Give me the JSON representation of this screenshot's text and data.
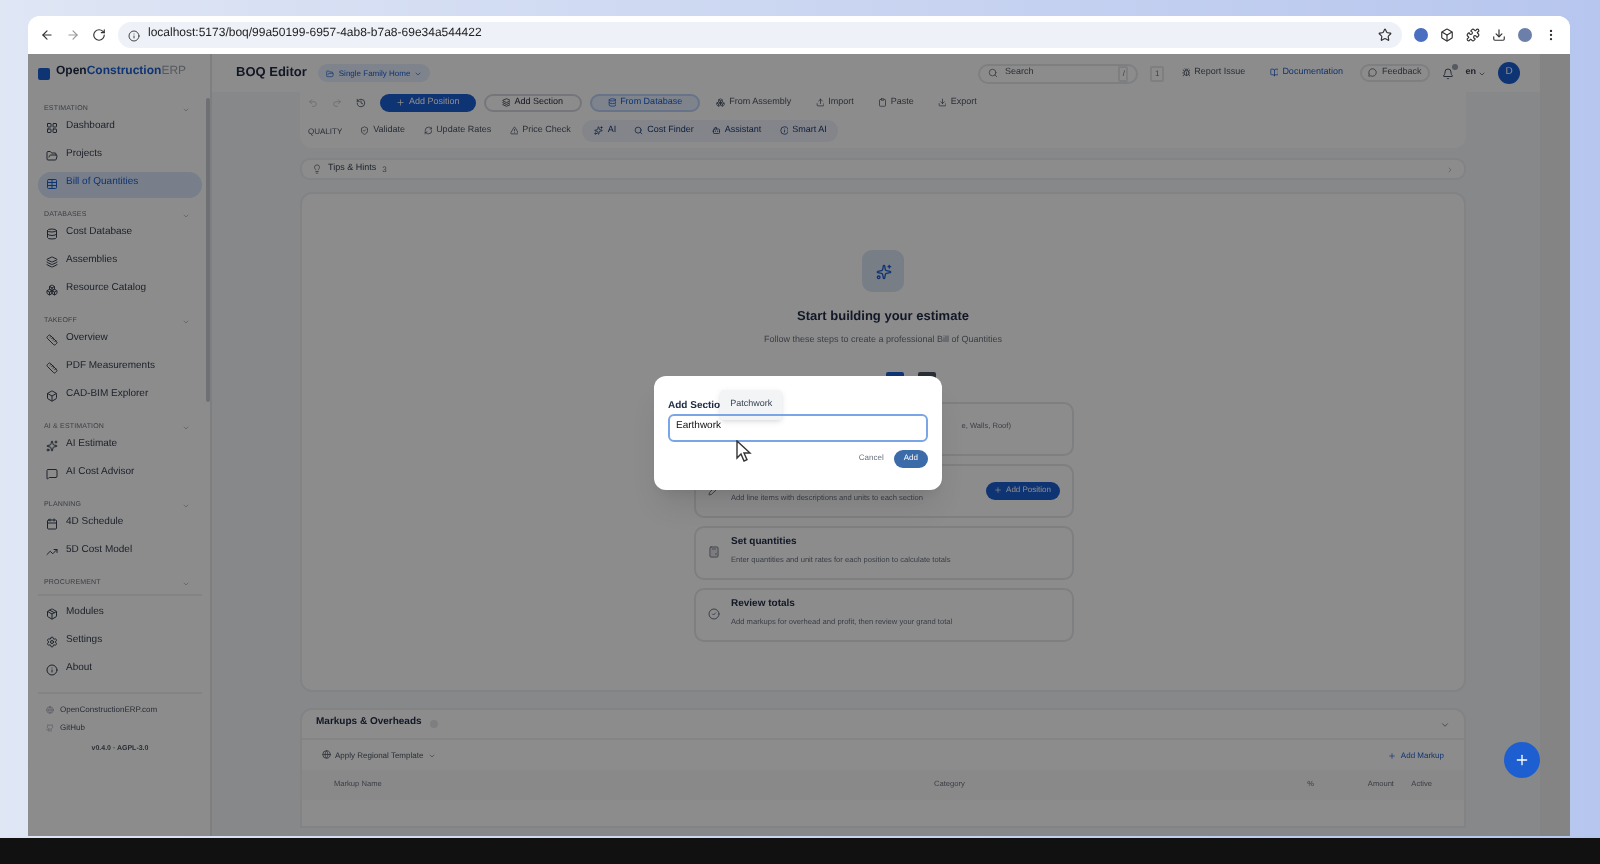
{
  "browser": {
    "url": "localhost:5173/boq/99a50199-6957-4ab8-b7a8-69e34a544422"
  },
  "sidebar": {
    "logo": [
      "Open",
      "Construction",
      "ERP"
    ],
    "groups": [
      {
        "title": "ESTIMATION",
        "items": [
          {
            "label": "Dashboard",
            "selected": false
          },
          {
            "label": "Projects",
            "selected": false
          },
          {
            "label": "Bill of Quantities",
            "selected": true
          }
        ]
      },
      {
        "title": "DATABASES",
        "items": [
          {
            "label": "Cost Database",
            "selected": false
          },
          {
            "label": "Assemblies",
            "selected": false
          },
          {
            "label": "Resource Catalog",
            "selected": false
          }
        ]
      },
      {
        "title": "TAKEOFF",
        "items": [
          {
            "label": "Overview",
            "selected": false
          },
          {
            "label": "PDF Measurements",
            "selected": false
          },
          {
            "label": "CAD-BIM Explorer",
            "selected": false
          }
        ]
      },
      {
        "title": "AI & ESTIMATION",
        "items": [
          {
            "label": "AI Estimate",
            "selected": false
          },
          {
            "label": "AI Cost Advisor",
            "selected": false
          }
        ]
      },
      {
        "title": "PLANNING",
        "items": [
          {
            "label": "4D Schedule",
            "selected": false
          },
          {
            "label": "5D Cost Model",
            "selected": false
          }
        ]
      },
      {
        "title": "PROCUREMENT"
      }
    ],
    "system_items": [
      "Modules",
      "Settings",
      "About"
    ],
    "links": [
      "OpenConstructionERP.com",
      "GitHub"
    ],
    "version": "v0.4.0 · AGPL-3.0"
  },
  "header": {
    "page_title": "BOQ Editor",
    "project": "Single Family Home",
    "search_placeholder": "Search",
    "search_shortcut": "/",
    "shortcut_count": "1",
    "links": [
      "Report Issue",
      "Documentation",
      "Feedback"
    ],
    "language": "en",
    "avatar": "D"
  },
  "toolbar": [
    {
      "label": "Add Position",
      "kind": "primary"
    },
    {
      "label": "Add Section",
      "kind": "outline"
    },
    {
      "label": "From Database",
      "kind": "soft"
    },
    {
      "label": "From Assembly",
      "kind": "plain"
    },
    {
      "label": "Import",
      "kind": "plain"
    },
    {
      "label": "Paste",
      "kind": "plain"
    },
    {
      "label": "Export",
      "kind": "plain"
    }
  ],
  "quality": {
    "label": "QUALITY",
    "buttons": [
      "Validate",
      "Update Rates",
      "Price Check"
    ],
    "ai_buttons": [
      "AI",
      "Cost Finder",
      "Assistant",
      "Smart AI"
    ]
  },
  "tips": {
    "label": "Tips & Hints",
    "count": "3"
  },
  "empty_state": {
    "title": "Start building your estimate",
    "subtitle": "Follow these steps to create a professional Bill of Quantities",
    "view_toggles": [
      {
        "selected": true
      },
      {
        "selected": false
      }
    ],
    "steps": [
      {
        "description": "e, Walls, Roof)"
      },
      {
        "description": "Add line items with descriptions and units to each section",
        "action": "Add Position"
      },
      {
        "title": "Set quantities",
        "description": "Enter quantities and unit rates for each position to calculate totals"
      },
      {
        "title": "Review totals",
        "description": "Add markups for overhead and profit, then review your grand total"
      }
    ]
  },
  "markups": {
    "title": "Markups & Overheads",
    "template_button": "Apply Regional Template",
    "add_button": "Add Markup",
    "columns": [
      "Markup Name",
      "Category",
      "%",
      "Amount",
      "Active"
    ]
  },
  "dialog": {
    "title": "Add Sectio",
    "value": "Earthwork",
    "buttons": [
      "Cancel",
      "Add"
    ]
  },
  "tooltip": "Patchwork"
}
